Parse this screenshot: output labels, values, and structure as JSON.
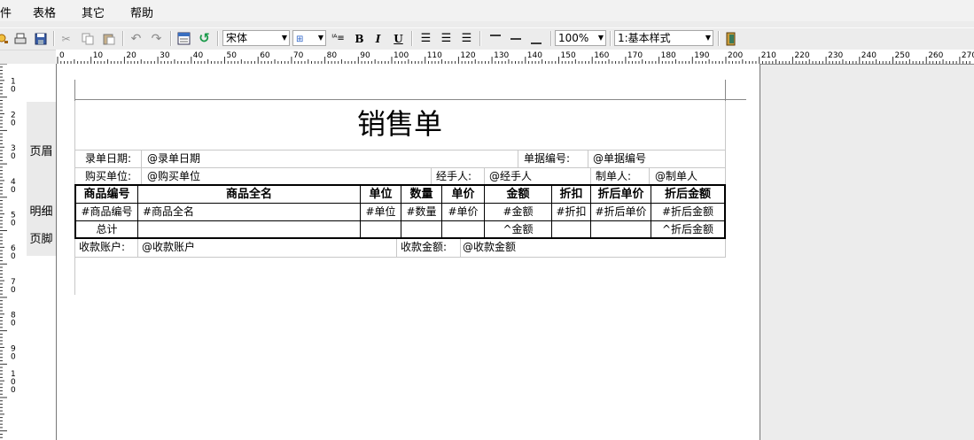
{
  "menubar": {
    "items": [
      "件",
      "表格",
      "其它",
      "帮助"
    ]
  },
  "toolbar": {
    "font_name": "宋体",
    "bold": "B",
    "italic": "I",
    "underline": "U",
    "zoom": "100%",
    "style": "1:基本样式"
  },
  "ruler": {
    "h_labels": [
      "0",
      "10",
      "20",
      "30",
      "40",
      "50",
      "60",
      "70",
      "80",
      "90",
      "100",
      "110",
      "120",
      "130",
      "140",
      "150",
      "160",
      "170",
      "180",
      "190",
      "200",
      "210",
      "220",
      "230",
      "240",
      "250",
      "260",
      "270"
    ],
    "v_labels": [
      "1 0",
      "2 0",
      "3 0",
      "4 0",
      "5 0",
      "6 0",
      "7 0",
      "8 0",
      "9 0",
      "1 0 0"
    ]
  },
  "bands": {
    "header": "页眉",
    "detail": "明细",
    "footer": "页脚"
  },
  "report": {
    "title": "销售单",
    "row1": {
      "date_label": "录单日期:",
      "date_value": "@录单日期",
      "bill_label": "单据编号:",
      "bill_value": "@单据编号"
    },
    "row2": {
      "buyer_label": "购买单位:",
      "buyer_value": "@购买单位",
      "handler_label": "经手人:",
      "handler_value": "@经手人",
      "maker_label": "制单人:",
      "maker_value": "@制单人"
    },
    "columns": [
      "商品编号",
      "商品全名",
      "单位",
      "数量",
      "单价",
      "金额",
      "折扣",
      "折后单价",
      "折后金额"
    ],
    "detail": [
      "#商品编号",
      "#商品全名",
      "#单位",
      "#数量",
      "#单价",
      "#金额",
      "#折扣",
      "#折后单价",
      "#折后金额"
    ],
    "footer": {
      "total_label": "总计",
      "amount": "^金额",
      "discount_amount": "^折后金额"
    },
    "bottom": {
      "account_label": "收款账户:",
      "account_value": "@收款账户",
      "sum_label": "收款金额:",
      "sum_value": "@收款金额"
    }
  }
}
